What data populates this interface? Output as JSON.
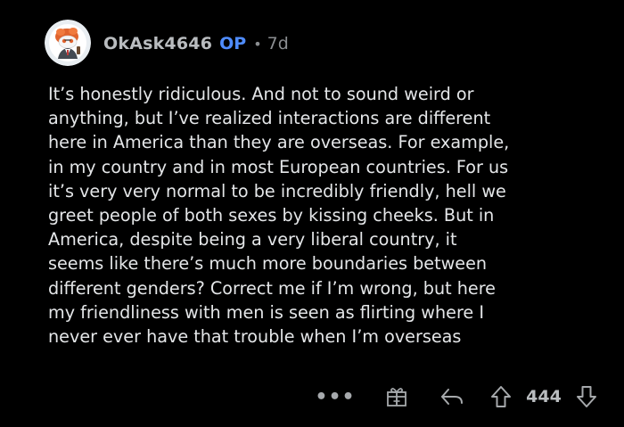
{
  "comment": {
    "author": {
      "username": "OkAsk4646",
      "op_badge": "OP",
      "separator": "•",
      "age": "7d",
      "avatar_icon": "snoo-avatar-icon"
    },
    "body_lines": [
      "It’s honestly ridiculous. And not to sound weird or",
      "anything, but I’ve realized interactions are different",
      "here in America than they are overseas. For example,",
      "in my country and in most European countries. For us",
      "it’s very very normal to be incredibly friendly, hell we",
      "greet people of both sexes by kissing cheeks. But in",
      "America, despite being a very liberal country, it",
      "seems like there’s much more boundaries between",
      "different genders? Correct me if I’m wrong, but here",
      "my friendliness with men is seen as flirting where I",
      "never ever have that trouble when I’m overseas"
    ],
    "actions": {
      "more_label": "•••",
      "award_icon": "gift-award-icon",
      "reply_icon": "reply-arrow-icon",
      "upvote_icon": "upvote-arrow-icon",
      "score": "444",
      "downvote_icon": "downvote-arrow-icon"
    }
  },
  "colors": {
    "background": "#000000",
    "op_badge": "#4f8cff",
    "text": "#e4e6e8",
    "muted": "#8b8e91"
  }
}
